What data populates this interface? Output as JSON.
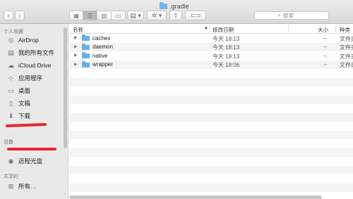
{
  "window": {
    "title": ".gradle"
  },
  "toolbar": {
    "back_glyph": "‹",
    "forward_glyph": "›",
    "view_icon_glyph": "▦",
    "view_list_glyph": "☰",
    "view_column_glyph": "▥",
    "view_gallery_glyph": "▭",
    "group_glyph": "▤ ▾",
    "action_glyph": "✲ ▾",
    "share_glyph": "⇧",
    "tag_glyph": "⊂⊃"
  },
  "search": {
    "placeholder": "搜索",
    "icon": "search-icon"
  },
  "sidebar": {
    "favorites_header": "个人收藏",
    "favorites": [
      {
        "label": "AirDrop",
        "icon": "airdrop-icon"
      },
      {
        "label": "我的所有文件",
        "icon": "all-files-icon"
      },
      {
        "label": "iCloud Drive",
        "icon": "cloud-icon"
      },
      {
        "label": "应用程序",
        "icon": "applications-icon"
      },
      {
        "label": "桌面",
        "icon": "desktop-icon"
      },
      {
        "label": "文稿",
        "icon": "documents-icon"
      },
      {
        "label": "下载",
        "icon": "downloads-icon"
      }
    ],
    "devices_header": "设备",
    "devices": [
      {
        "label": "远程光盘",
        "icon": "remote-disc-icon"
      }
    ],
    "shared_header": "共享的",
    "shared": [
      {
        "label": "所有…",
        "icon": "network-icon"
      }
    ]
  },
  "table": {
    "columns": {
      "name": "名称",
      "date": "修改日期",
      "size": "大小",
      "kind": "种类"
    },
    "rows": [
      {
        "name": "caches",
        "date": "今天 18:13",
        "size": "--",
        "kind": "文件夹"
      },
      {
        "name": "daemon",
        "date": "今天 18:13",
        "size": "--",
        "kind": "文件夹"
      },
      {
        "name": "native",
        "date": "今天 18:13",
        "size": "--",
        "kind": "文件夹"
      },
      {
        "name": "wrapper",
        "date": "今天 18:06",
        "size": "--",
        "kind": "文件夹"
      }
    ]
  },
  "colors": {
    "folder": "#67b0e6",
    "redaction": "#e8262a"
  }
}
